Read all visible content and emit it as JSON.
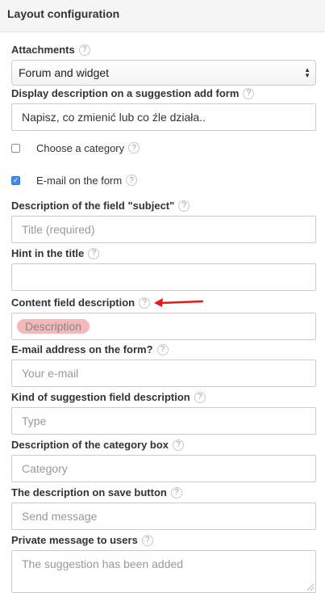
{
  "panel": {
    "title": "Layout configuration"
  },
  "help_glyph": "?",
  "fields": {
    "attachments": {
      "label": "Attachments",
      "value": "Forum and widget"
    },
    "display_description": {
      "label": "Display description on a suggestion add form",
      "value": "Napisz, co zmienić lub co źle działa.."
    },
    "choose_category": {
      "label": "Choose a category",
      "checked": false
    },
    "email_on_form": {
      "label": "E-mail on the form",
      "checked": true
    },
    "subject_description": {
      "label": "Description of the field \"subject\"",
      "placeholder": "Title (required)"
    },
    "hint_in_title": {
      "label": "Hint in the title",
      "placeholder": ""
    },
    "content_description": {
      "label": "Content field description",
      "placeholder": "Description"
    },
    "email_address": {
      "label": "E-mail address on the form?",
      "placeholder": "Your e-mail"
    },
    "kind_description": {
      "label": "Kind of suggestion field description",
      "placeholder": "Type"
    },
    "category_box": {
      "label": "Description of the category box",
      "placeholder": "Category"
    },
    "save_button_description": {
      "label": "The description on save button",
      "placeholder": "Send message"
    },
    "private_message": {
      "label": "Private message to users",
      "placeholder": "The suggestion has been added"
    }
  },
  "colors": {
    "accent": "#3b8de8",
    "annotation_arrow": "#e01b1b",
    "highlight": "#f4b8b8"
  },
  "icons": {
    "help": "question-circle-icon",
    "select": "chevron-up-down-icon",
    "annotation": "red-arrow-icon"
  }
}
